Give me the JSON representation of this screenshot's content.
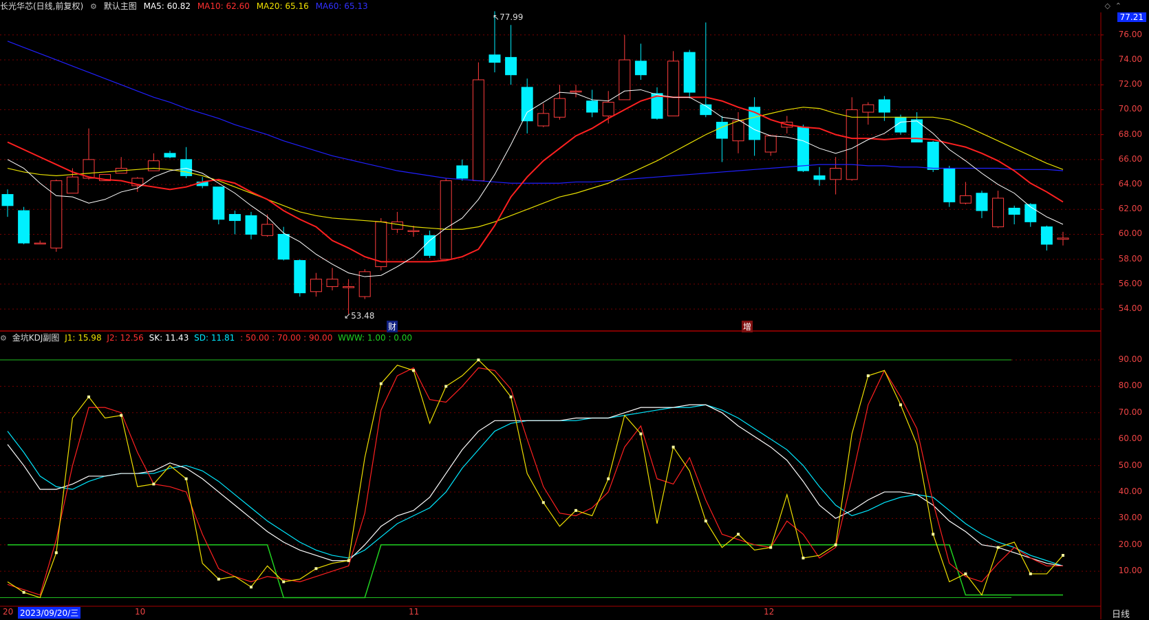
{
  "main_header": {
    "title": "长光华芯(日线,前复权)",
    "main_label": "默认主图",
    "ma5": "MA5: 60.82",
    "ma10": "MA10: 62.60",
    "ma20": "MA20: 65.16",
    "ma60": "MA60: 65.13"
  },
  "sub_header": {
    "title": "金坑KDJ副图",
    "j1": "J1: 15.98",
    "j2": "J2: 12.56",
    "sk": "SK: 11.43",
    "sd": "SD: 11.81",
    "levels": ": 50.00 : 70.00 : 90.00",
    "www": "WWW: 1.00 : 0.00"
  },
  "annotations": {
    "high": "77.99",
    "low": "53.48",
    "marker_cai": "财",
    "marker_zeng": "增"
  },
  "current_price": "77.21",
  "price_axis": [
    "76.00",
    "74.00",
    "72.00",
    "70.00",
    "68.00",
    "66.00",
    "64.00",
    "62.00",
    "60.00",
    "58.00",
    "56.00",
    "54.00"
  ],
  "kdj_axis": [
    "90.00",
    "80.00",
    "70.00",
    "60.00",
    "50.00",
    "40.00",
    "30.00",
    "20.00",
    "10.00"
  ],
  "x_axis": {
    "date_box": "2023/09/20/三",
    "m10": "10",
    "m11": "11",
    "m12": "12",
    "prefix": "20",
    "period": "日线"
  },
  "colors": {
    "up": "#ff3d3d",
    "down": "#00f0ff",
    "ma5": "#ffffff",
    "ma10": "#ff2020",
    "ma20": "#e8e000",
    "ma60": "#2020ff",
    "grid": "#7a0000"
  },
  "chart_data": {
    "type": "candlestick",
    "price_range": [
      53,
      77.5
    ],
    "candles": [
      [
        63.2,
        62.3,
        63.6,
        61.4
      ],
      [
        61.9,
        59.3,
        62.2,
        59.2
      ],
      [
        59.3,
        59.3,
        59.5,
        59.2
      ],
      [
        58.9,
        64.3,
        64.4,
        58.6
      ],
      [
        63.3,
        64.6,
        65.3,
        63.3
      ],
      [
        64.5,
        66.0,
        68.5,
        64.4
      ],
      [
        64.3,
        64.8,
        64.8,
        64.3
      ],
      [
        64.9,
        65.3,
        66.2,
        64.9
      ],
      [
        63.9,
        64.5,
        64.6,
        63.4
      ],
      [
        65.1,
        65.9,
        66.5,
        65.1
      ],
      [
        66.5,
        66.2,
        66.7,
        66.1
      ],
      [
        66.0,
        64.7,
        67.0,
        64.5
      ],
      [
        64.2,
        63.9,
        64.6,
        63.7
      ],
      [
        63.8,
        61.2,
        63.8,
        60.8
      ],
      [
        61.6,
        61.1,
        61.9,
        60.0
      ],
      [
        61.5,
        60.0,
        61.8,
        59.6
      ],
      [
        59.9,
        60.8,
        61.6,
        59.8
      ],
      [
        60.0,
        58.0,
        60.6,
        57.9
      ],
      [
        57.9,
        55.3,
        58.0,
        55.0
      ],
      [
        55.4,
        56.4,
        56.9,
        55.0
      ],
      [
        55.8,
        56.4,
        57.3,
        55.5
      ],
      [
        55.8,
        55.8,
        56.4,
        53.6
      ],
      [
        55.0,
        57.0,
        57.2,
        54.8
      ],
      [
        57.4,
        61.0,
        61.3,
        57.1
      ],
      [
        60.4,
        61.0,
        61.8,
        60.1
      ],
      [
        60.3,
        60.3,
        60.7,
        59.8
      ],
      [
        59.9,
        58.3,
        60.3,
        58.1
      ],
      [
        58.0,
        64.3,
        64.5,
        58.0
      ],
      [
        65.5,
        64.5,
        66.0,
        64.3
      ],
      [
        64.3,
        72.4,
        73.8,
        64.3
      ],
      [
        74.4,
        73.8,
        77.9,
        73.0
      ],
      [
        74.2,
        72.8,
        76.8,
        72.0
      ],
      [
        71.8,
        69.1,
        72.5,
        68.1
      ],
      [
        68.7,
        69.7,
        70.5,
        68.6
      ],
      [
        69.4,
        70.9,
        72.0,
        69.2
      ],
      [
        71.5,
        71.5,
        72.0,
        71.0
      ],
      [
        70.7,
        69.8,
        71.6,
        69.4
      ],
      [
        69.5,
        70.6,
        71.5,
        68.9
      ],
      [
        70.8,
        74.0,
        76.0,
        70.8
      ],
      [
        73.9,
        72.8,
        75.3,
        72.4
      ],
      [
        71.3,
        69.3,
        71.8,
        69.2
      ],
      [
        69.5,
        73.9,
        74.7,
        69.5
      ],
      [
        74.6,
        71.4,
        74.8,
        70.9
      ],
      [
        70.4,
        69.6,
        77.0,
        69.4
      ],
      [
        69.0,
        67.7,
        69.5,
        65.8
      ],
      [
        67.5,
        69.1,
        69.8,
        66.5
      ],
      [
        70.2,
        67.6,
        71.0,
        66.3
      ],
      [
        66.6,
        67.9,
        68.0,
        66.3
      ],
      [
        68.6,
        69.0,
        69.5,
        68.1
      ],
      [
        68.6,
        65.1,
        68.8,
        65.0
      ],
      [
        64.7,
        64.4,
        65.4,
        63.9
      ],
      [
        64.4,
        65.3,
        66.2,
        63.2
      ],
      [
        64.4,
        70.0,
        71.0,
        64.3
      ],
      [
        69.8,
        70.4,
        70.6,
        68.8
      ],
      [
        70.8,
        69.8,
        71.1,
        69.1
      ],
      [
        69.4,
        68.2,
        69.6,
        68.0
      ],
      [
        69.2,
        67.4,
        69.8,
        67.4
      ],
      [
        67.4,
        65.2,
        67.5,
        65.0
      ],
      [
        65.3,
        62.6,
        65.5,
        62.2
      ],
      [
        62.5,
        63.1,
        64.2,
        62.4
      ],
      [
        63.3,
        61.9,
        63.5,
        61.3
      ],
      [
        60.6,
        62.9,
        63.5,
        60.5
      ],
      [
        62.1,
        61.6,
        62.3,
        60.8
      ],
      [
        62.4,
        61.0,
        62.5,
        60.6
      ],
      [
        60.6,
        59.2,
        60.7,
        58.7
      ],
      [
        59.6,
        59.7,
        60.2,
        59.1
      ]
    ],
    "ma5": [
      66.0,
      65.3,
      64.1,
      63.1,
      63.0,
      62.5,
      62.8,
      63.4,
      63.7,
      64.6,
      65.1,
      65.3,
      64.9,
      64.1,
      63.3,
      62.3,
      61.4,
      60.1,
      59.4,
      58.4,
      57.6,
      56.9,
      56.6,
      56.7,
      57.4,
      58.2,
      59.5,
      60.5,
      61.3,
      62.8,
      64.8,
      67.2,
      69.8,
      70.6,
      71.4,
      71.3,
      70.8,
      70.7,
      71.5,
      71.6,
      71.2,
      71.0,
      71.0,
      70.3,
      69.4,
      69.2,
      68.4,
      67.9,
      67.8,
      67.5,
      66.9,
      66.5,
      66.9,
      67.6,
      68.1,
      69.0,
      69.1,
      68.1,
      66.8,
      65.9,
      64.9,
      64.0,
      63.3,
      62.2,
      61.4,
      60.8
    ],
    "ma10": [
      67.4,
      66.8,
      66.2,
      65.6,
      65.0,
      64.6,
      64.4,
      64.3,
      64.0,
      63.8,
      63.6,
      63.8,
      64.2,
      64.4,
      64.1,
      63.4,
      62.8,
      61.9,
      61.2,
      60.6,
      59.5,
      58.9,
      58.2,
      57.8,
      57.8,
      57.8,
      57.8,
      57.9,
      58.2,
      58.8,
      60.7,
      63.0,
      64.6,
      65.9,
      66.9,
      67.9,
      68.5,
      69.3,
      70.0,
      70.7,
      71.1,
      71.0,
      71.0,
      71.0,
      70.7,
      70.2,
      69.8,
      69.2,
      68.8,
      68.6,
      68.5,
      68.0,
      67.7,
      67.7,
      67.6,
      67.7,
      67.7,
      67.6,
      67.3,
      67.0,
      66.5,
      65.9,
      65.1,
      64.1,
      63.4,
      62.6
    ],
    "ma20": [
      65.3,
      65.0,
      64.8,
      64.7,
      64.8,
      64.9,
      65.0,
      65.1,
      65.2,
      65.3,
      65.2,
      65.0,
      64.7,
      64.3,
      63.8,
      63.3,
      62.8,
      62.3,
      61.8,
      61.5,
      61.3,
      61.2,
      61.1,
      61.0,
      60.8,
      60.6,
      60.5,
      60.4,
      60.4,
      60.6,
      61.0,
      61.5,
      62.0,
      62.5,
      63.0,
      63.3,
      63.7,
      64.1,
      64.7,
      65.3,
      65.9,
      66.6,
      67.3,
      68.0,
      68.6,
      69.1,
      69.4,
      69.7,
      70.0,
      70.2,
      70.1,
      69.7,
      69.4,
      69.4,
      69.4,
      69.4,
      69.4,
      69.4,
      69.2,
      68.7,
      68.1,
      67.5,
      66.9,
      66.3,
      65.7,
      65.2
    ],
    "ma60": [
      75.5,
      75.0,
      74.5,
      74.0,
      73.5,
      73.0,
      72.5,
      72.0,
      71.5,
      71.0,
      70.6,
      70.1,
      69.7,
      69.3,
      68.8,
      68.4,
      68.0,
      67.5,
      67.1,
      66.7,
      66.3,
      66.0,
      65.7,
      65.4,
      65.1,
      64.9,
      64.7,
      64.5,
      64.4,
      64.3,
      64.2,
      64.1,
      64.1,
      64.1,
      64.1,
      64.2,
      64.2,
      64.3,
      64.4,
      64.5,
      64.6,
      64.7,
      64.8,
      64.9,
      65.0,
      65.1,
      65.2,
      65.3,
      65.4,
      65.5,
      65.6,
      65.6,
      65.6,
      65.5,
      65.5,
      65.4,
      65.4,
      65.3,
      65.3,
      65.3,
      65.3,
      65.3,
      65.2,
      65.2,
      65.2,
      65.1
    ],
    "kdj_range": [
      -5,
      95
    ],
    "j1": [
      6,
      2,
      0,
      17,
      68,
      76,
      68,
      69,
      42,
      43,
      50,
      45,
      13,
      7,
      8,
      4,
      12,
      6,
      7,
      11,
      13,
      14,
      53,
      81,
      88,
      86,
      66,
      80,
      84,
      90,
      84,
      76,
      47,
      36,
      27,
      33,
      31,
      45,
      69,
      62,
      28,
      57,
      48,
      29,
      19,
      24,
      18,
      19,
      39,
      15,
      16,
      20,
      62,
      84,
      86,
      73,
      58,
      24,
      6,
      9,
      1,
      19,
      21,
      9,
      9,
      16
    ],
    "j2": [
      5,
      3,
      1,
      22,
      50,
      72,
      72,
      70,
      55,
      43,
      42,
      40,
      24,
      11,
      8,
      6,
      8,
      7,
      6,
      8,
      10,
      12,
      32,
      71,
      84,
      87,
      75,
      74,
      80,
      87,
      86,
      79,
      60,
      42,
      32,
      31,
      34,
      40,
      57,
      65,
      45,
      43,
      53,
      37,
      24,
      22,
      20,
      19,
      29,
      24,
      15,
      19,
      45,
      73,
      86,
      76,
      64,
      36,
      13,
      8,
      6,
      13,
      19,
      15,
      12,
      12
    ],
    "sk": [
      58,
      50,
      41,
      41,
      43,
      46,
      46,
      47,
      47,
      48,
      51,
      49,
      45,
      40,
      35,
      30,
      25,
      21,
      18,
      16,
      14,
      14,
      20,
      27,
      31,
      33,
      38,
      47,
      56,
      63,
      67,
      67,
      67,
      67,
      67,
      68,
      68,
      68,
      70,
      72,
      72,
      72,
      73,
      73,
      70,
      65,
      61,
      57,
      52,
      44,
      35,
      30,
      33,
      37,
      40,
      40,
      39,
      35,
      29,
      25,
      20,
      19,
      17,
      15,
      13,
      12
    ],
    "sd": [
      63,
      55,
      46,
      42,
      41,
      44,
      46,
      47,
      47,
      47,
      49,
      50,
      48,
      44,
      39,
      34,
      29,
      25,
      21,
      18,
      16,
      15,
      18,
      23,
      28,
      31,
      34,
      40,
      49,
      56,
      63,
      66,
      67,
      67,
      67,
      67,
      68,
      68,
      69,
      70,
      71,
      72,
      72,
      73,
      71,
      68,
      64,
      60,
      56,
      50,
      42,
      35,
      31,
      33,
      36,
      38,
      39,
      38,
      33,
      28,
      24,
      21,
      19,
      16,
      14,
      12
    ],
    "zone": [
      20,
      20,
      20,
      20,
      20,
      20,
      20,
      20,
      20,
      20,
      20,
      20,
      20,
      20,
      20,
      20,
      20,
      0,
      0,
      0,
      0,
      0,
      0,
      20,
      20,
      20,
      20,
      20,
      20,
      20,
      20,
      20,
      20,
      20,
      20,
      20,
      20,
      20,
      20,
      20,
      20,
      20,
      20,
      20,
      20,
      20,
      20,
      20,
      20,
      20,
      20,
      20,
      20,
      20,
      20,
      20,
      20,
      20,
      20,
      1,
      1,
      1,
      1,
      1,
      1,
      1
    ]
  }
}
